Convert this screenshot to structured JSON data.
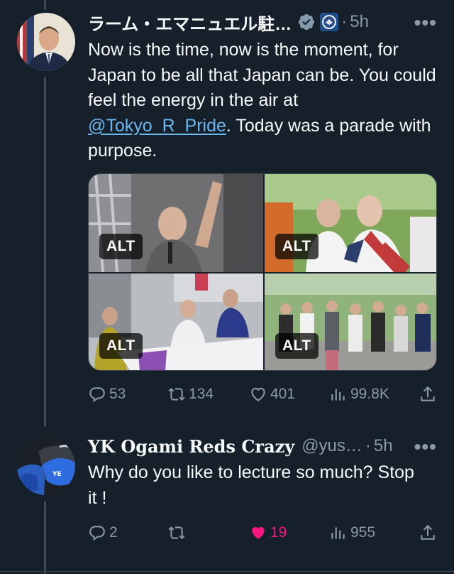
{
  "tweet1": {
    "display_name": "ラーム・エマニュエル駐…",
    "time": "5h",
    "text_pre": "Now is the time, now is the moment, for Japan to be all that Japan can be. You could feel the energy in the air at ",
    "mention": "@Tokyo_R_Pride",
    "text_post": ". Today was a parade with purpose.",
    "media": [
      {
        "alt_badge": "ALT",
        "icon": "photo-speaker-stage"
      },
      {
        "alt_badge": "ALT",
        "icon": "photo-flag-wrapped"
      },
      {
        "alt_badge": "ALT",
        "icon": "photo-parade-banner"
      },
      {
        "alt_badge": "ALT",
        "icon": "photo-crowd-group"
      }
    ],
    "replies": "53",
    "retweets": "134",
    "likes": "401",
    "views": "99.8K"
  },
  "tweet2": {
    "display_name": "YK Ogami Reds Crazy",
    "handle": "@yus…",
    "time": "5h",
    "text": "Why do you like to lecture so much? Stop it !",
    "replies": "2",
    "retweets": "",
    "likes": "19",
    "views": "955",
    "liked": true
  },
  "separator": "·",
  "more_glyph": "•••",
  "colors": {
    "background": "#15202b",
    "text": "#f7f9f9",
    "secondary": "#8b98a5",
    "link": "#6cb6ee",
    "like": "#f91880",
    "verified_badge": "#829aab"
  }
}
